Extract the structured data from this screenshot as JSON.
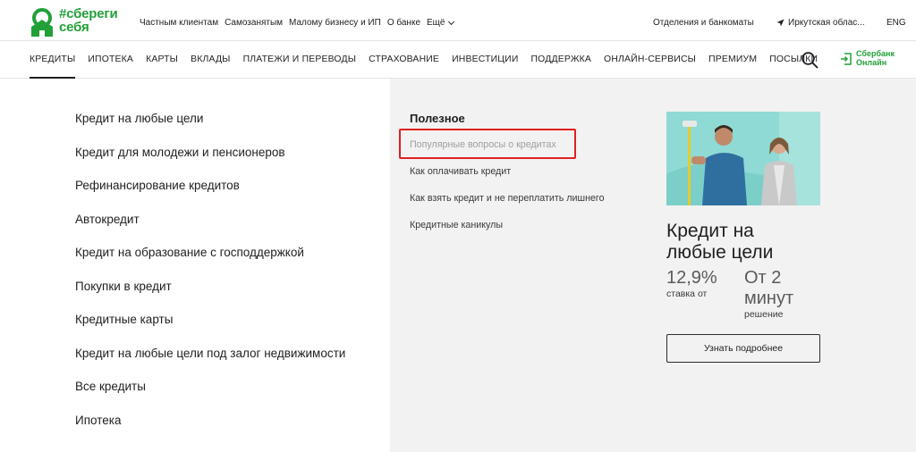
{
  "brand": {
    "line1": "#сбереги",
    "line2": "себя",
    "color": "#21a038"
  },
  "top_nav": [
    "Частным клиентам",
    "Самозанятым",
    "Малому бизнесу и ИП",
    "О банке"
  ],
  "top_more": "Ещё",
  "branches": "Отделения и банкоматы",
  "city": "Иркутская облас...",
  "lang": "ENG",
  "main_nav": [
    "КРЕДИТЫ",
    "ИПОТЕКА",
    "КАРТЫ",
    "ВКЛАДЫ",
    "ПЛАТЕЖИ И ПЕРЕВОДЫ",
    "СТРАХОВАНИЕ",
    "ИНВЕСТИЦИИ",
    "ПОДДЕРЖКА",
    "ОНЛАЙН-СЕРВИСЫ",
    "ПРЕМИУМ",
    "ПОСЫЛКИ"
  ],
  "active_nav": "КРЕДИТЫ",
  "online_button": {
    "line1": "Сбербанк",
    "line2": "Онлайн"
  },
  "credit_menu": [
    "Кредит на любые цели",
    "Кредит для молодежи и пенсионеров",
    "Рефинансирование кредитов",
    "Автокредит",
    "Кредит на образование с господдержкой",
    "Покупки в кредит",
    "Кредитные карты",
    "Кредит на любые цели под залог недвижимости",
    "Все кредиты",
    "Ипотека"
  ],
  "useful": {
    "title": "Полезное",
    "links": [
      "Популярные вопросы о кредитах",
      "Как оплачивать кредит",
      "Как взять кредит и не переплатить лишнего",
      "Кредитные каникулы"
    ]
  },
  "promo": {
    "title_line1": "Кредит на",
    "title_line2": "любые цели",
    "rate_value": "12,9%",
    "rate_label": "ставка от",
    "time_line1": "От 2",
    "time_line2": "минут",
    "time_label": "решение",
    "button": "Узнать подробнее"
  },
  "colors": {
    "accent_green": "#21a038",
    "highlight_red": "#e02020",
    "panel_gray": "#f2f2f2"
  }
}
